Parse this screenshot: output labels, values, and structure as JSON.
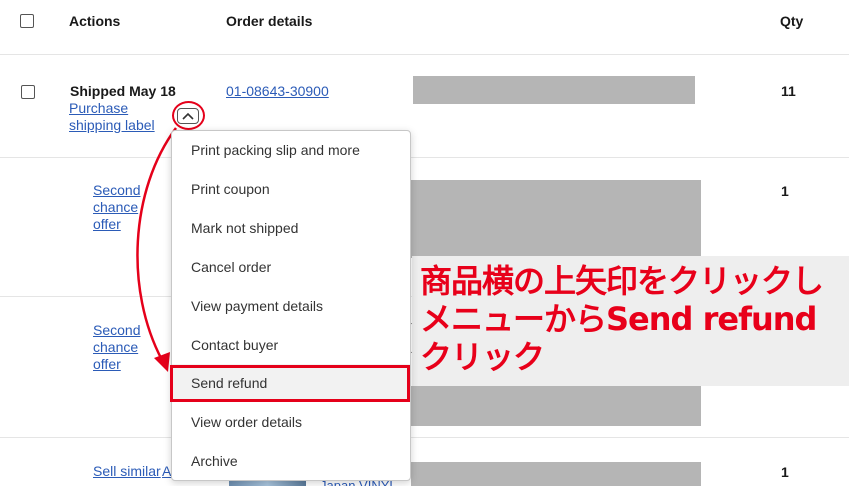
{
  "table": {
    "headers": {
      "actions": "Actions",
      "order_details": "Order details",
      "qty": "Qty"
    },
    "rows": [
      {
        "status": "Shipped May 18",
        "link": "Purchase shipping label",
        "order_id": "01-08643-30900",
        "qty": "11"
      },
      {
        "link": "Second chance offer",
        "qty": "1"
      },
      {
        "link": "Second chance offer"
      },
      {
        "link": "Sell similar",
        "link2": "Archive",
        "partial": "Japan VINYL",
        "qty": "1"
      }
    ]
  },
  "menu": {
    "items": [
      "Print packing slip and more",
      "Print coupon",
      "Mark not shipped",
      "Cancel order",
      "View payment details",
      "Contact buyer",
      "Send refund",
      "View order details",
      "Archive"
    ]
  },
  "annotation": {
    "line1": "商品横の上矢印をクリックし",
    "line2": "メニューからSend refund",
    "line3": "クリック",
    "color": "#e8001a"
  }
}
